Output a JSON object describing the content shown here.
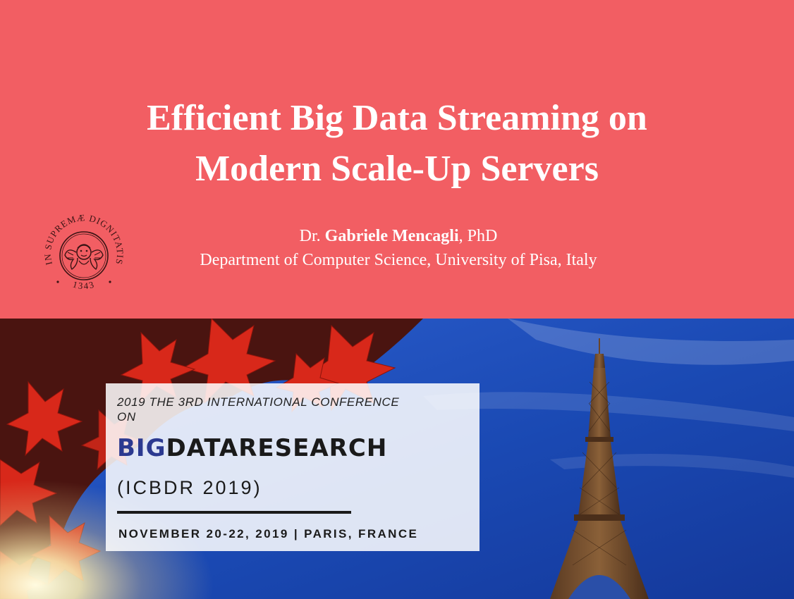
{
  "slide": {
    "title_lines": [
      "Efficient Big Data Streaming on",
      "Modern Scale-Up Servers"
    ],
    "author": {
      "prefix": "Dr.",
      "name": "Gabriele Mencagli",
      "suffix": ", PhD",
      "affiliation": "Department of Computer Science, University of Pisa, Italy"
    },
    "seal": {
      "motto": "IN SUPREMÆ DIGNITATIS",
      "year": "1343"
    }
  },
  "conference": {
    "line1": "2019 THE 3RD INTERNATIONAL CONFERENCE",
    "line2": "ON",
    "brand_part1": "BIG",
    "brand_part2": "DATARESEARCH",
    "abbreviation": "(ICBDR 2019)",
    "dates_location": "NOVEMBER 20-22, 2019 | PARIS, FRANCE"
  },
  "colors": {
    "banner": "#f25e63",
    "brand_blue": "#2b3990",
    "text_dark": "#1a1a1a",
    "sky": "#1c4fb8"
  }
}
